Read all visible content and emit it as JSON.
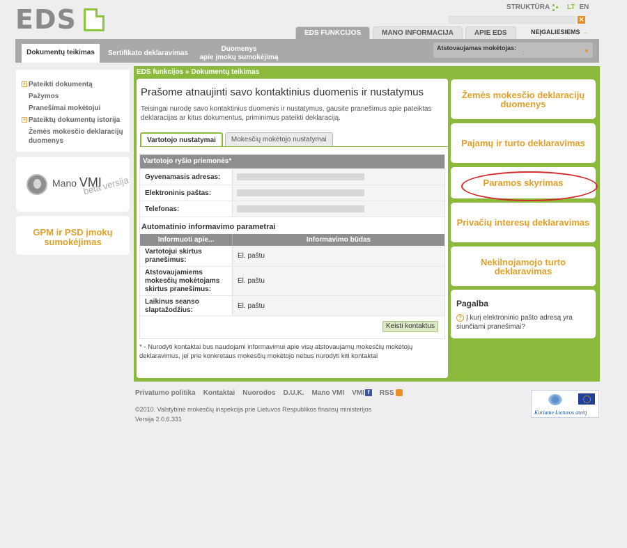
{
  "header": {
    "logo_text": "EDS",
    "structure_link": "STRUKTŪRA",
    "languages": [
      "LT",
      "EN"
    ],
    "main_tabs": [
      "EDS FUNKCIJOS",
      "MANO INFORMACIJA",
      "APIE EDS"
    ],
    "accessibility_link": "NEĮGALIESIEMS",
    "accessibility_arrow": "→"
  },
  "nav": {
    "tab_active": "Dokumentų teikimas",
    "tab_2": "Sertifikato deklaravimas",
    "tab_3_line1": "Duomenys",
    "tab_3_line2": "apie įmokų sumokėjimą",
    "taxpayer_label": "Atstovaujamas mokėtojas:",
    "taxpayer_sep": ":"
  },
  "sidebar": {
    "items": [
      {
        "label": "Pateikti dokumentą",
        "plus": true
      },
      {
        "label": "Pažymos",
        "plus": false
      },
      {
        "label": "Pranešimai mokėtojui",
        "plus": false
      },
      {
        "label": "Pateiktų dokumentų istorija",
        "plus": true
      },
      {
        "label": "Žemės mokesčio deklaracijų duomenys",
        "plus": false
      }
    ],
    "mano_vmi_prefix": "Mano",
    "mano_vmi_brand": "VMI",
    "mano_vmi_beta": "beta versija",
    "gpm_box": "GPM ir PSD įmokų sumokėjimas"
  },
  "breadcrumb": "EDS funkcijos » Dokumentų teikimas",
  "main": {
    "title": "Prašome atnaujinti savo kontaktinius duomenis ir nustatymus",
    "description": "Teisingai nurodę savo kontaktinius duomenis ir nustatymus, gausite pranešimus apie pateiktas deklaracijas ar kitus dokumentus, priminimus pateikti deklaraciją.",
    "tabs": [
      "Vartotojo nustatymai",
      "Mokesčių mokėtojo nustatymai"
    ],
    "section_header": "Vartotojo ryšio priemonės*",
    "contact_rows": [
      "Gyvenamasis adresas:",
      "Elektroninis paštas:",
      "Telefonas:"
    ],
    "auto_title": "Automatinio informavimo parametrai",
    "table_headers": [
      "Informuoti apie...",
      "Informavimo būdas"
    ],
    "table_rows": [
      {
        "label": "Vartotojui skirtus pranešimus:",
        "value": "El. paštu"
      },
      {
        "label": "Atstovaujamiems mokesčių mokėtojams skirtus pranešimus:",
        "value": "El. paštu"
      },
      {
        "label": "Laikinus seanso slaptažodžius:",
        "value": "El. paštu"
      }
    ],
    "change_button": "Keisti kontaktus",
    "note": "* - Nurodyti kontaktai bus naudojami informavimui apie visų atstovaujamų mokesčių mokėtojų deklaravimus, jei prie konkretaus mokesčių mokėtojo nebus nurodyti kiti kontaktai"
  },
  "right": {
    "boxes": [
      "Žemės mokesčio deklaracijų duomenys",
      "Pajamų ir turto deklaravimas",
      "Paramos skyrimas",
      "Privačių interesų deklaravimas",
      "Nekilnojamojo turto deklaravimas"
    ],
    "help_title": "Pagalba",
    "help_question_icon": "?",
    "help_question": "Į kurį elektroninio pašto adresą yra siunčiami pranešimai?"
  },
  "footer": {
    "links": [
      "Privatumo politika",
      "Kontaktai",
      "Nuorodos",
      "D.U.K.",
      "Mano VMI",
      "VMI",
      "RSS"
    ],
    "fb_letter": "f",
    "copyright": "©2010. Valstybinė mokesčių inspekcija prie Lietuvos Respublikos finansų ministerijos",
    "version": "Versija 2.0.6.331",
    "eu_slogan": "Kuriame Lietuvos ateitį"
  },
  "colors": {
    "accent_green": "#8ab93b",
    "accent_orange": "#e0a028",
    "highlight_red": "#d42a2a"
  }
}
